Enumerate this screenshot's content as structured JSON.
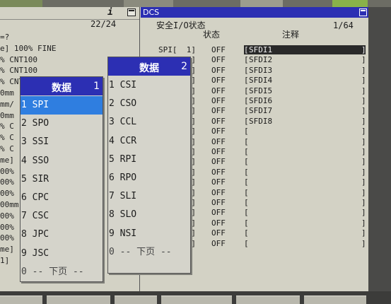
{
  "left_pane": {
    "page": "22/24",
    "lines": [
      "=?",
      "e] 100% FINE",
      "% CNT100",
      "% CNT100",
      "% CNT100",
      "0mm",
      "mm/",
      "0mm",
      "% C",
      "% C",
      "% C",
      "me]",
      "00%",
      "00%",
      "00%",
      "00mm",
      "00%",
      "00%",
      "00%",
      "me]",
      "1]"
    ]
  },
  "dcs": {
    "window_title": "DCS",
    "heading": "安全I/O状态",
    "col_status": "状态",
    "col_comment": "注释",
    "page": "1/64",
    "rows": [
      {
        "signal": "SPI[  1]",
        "value": "OFF",
        "comment": "SFDI1"
      },
      {
        "signal": "SPI[  2]",
        "value": "OFF",
        "comment": "SFDI2"
      },
      {
        "signal": "SPI[  3]",
        "value": "OFF",
        "comment": "SFDI3"
      },
      {
        "signal": "SPI[  4]",
        "value": "OFF",
        "comment": "SFDI4"
      },
      {
        "signal": "SPI[  5]",
        "value": "OFF",
        "comment": "SFDI5"
      },
      {
        "signal": "SPI[  6]",
        "value": "OFF",
        "comment": "SFDI6"
      },
      {
        "signal": "SPI[  7]",
        "value": "OFF",
        "comment": "SFDI7"
      },
      {
        "signal": "SPI[  8]",
        "value": "OFF",
        "comment": "SFDI8"
      },
      {
        "signal": "SPI[  9]",
        "value": "OFF",
        "comment": ""
      },
      {
        "signal": "SPI[ 10]",
        "value": "OFF",
        "comment": ""
      },
      {
        "signal": "SPI[ 11]",
        "value": "OFF",
        "comment": ""
      },
      {
        "signal": "SPI[ 12]",
        "value": "OFF",
        "comment": ""
      },
      {
        "signal": "SPI[ 13]",
        "value": "OFF",
        "comment": ""
      },
      {
        "signal": "SPI[ 14]",
        "value": "OFF",
        "comment": ""
      },
      {
        "signal": "SPI[ 15]",
        "value": "OFF",
        "comment": ""
      },
      {
        "signal": "SPI[ 16]",
        "value": "OFF",
        "comment": ""
      },
      {
        "signal": "SPI[ 17]",
        "value": "OFF",
        "comment": ""
      },
      {
        "signal": "SPI[ 18]",
        "value": "OFF",
        "comment": ""
      },
      {
        "signal": "SPI[ 19]",
        "value": "OFF",
        "comment": ""
      },
      {
        "signal": "SPI[ 20]",
        "value": "OFF",
        "comment": ""
      }
    ]
  },
  "menu1": {
    "title": "数据",
    "number": "1",
    "items": [
      "1 SPI",
      "2 SPO",
      "3 SSI",
      "4 SSO",
      "5 SIR",
      "6 CPC",
      "7 CSC",
      "8 JPC",
      "9 JSC",
      "0 -- 下页 --"
    ]
  },
  "menu2": {
    "title": "数据",
    "number": "2",
    "items": [
      "1 CSI",
      "2 CSO",
      "3 CCL",
      "4 CCR",
      "5 RPI",
      "6 RPO",
      "7 SLI",
      "8 SLO",
      "9 NSI",
      "0 -- 下页 --"
    ]
  },
  "colors": {
    "title_bar": "#2c2fb3",
    "selection": "#2f7ee0",
    "screen_bg": "#d3d2c5"
  }
}
